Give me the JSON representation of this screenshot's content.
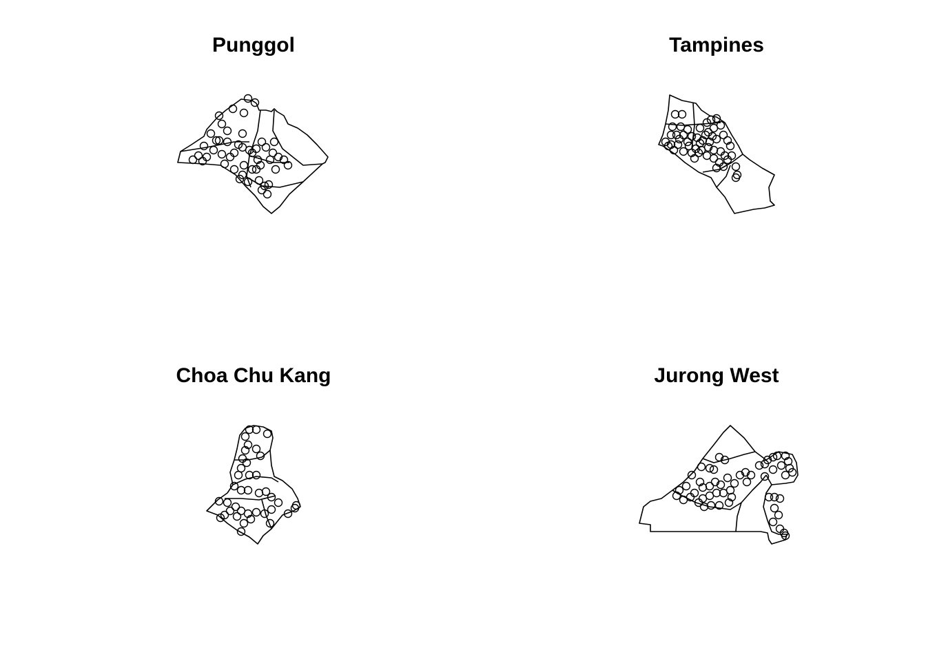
{
  "figure": {
    "stroke_color": "#000000",
    "background_color": "#ffffff",
    "point_symbol": "open-circle"
  },
  "panels": [
    {
      "id": "punggol",
      "title": "Punggol"
    },
    {
      "id": "tampines",
      "title": "Tampines"
    },
    {
      "id": "choa-chu-kang",
      "title": "Choa Chu Kang"
    },
    {
      "id": "jurong-west",
      "title": "Jurong West"
    }
  ]
}
